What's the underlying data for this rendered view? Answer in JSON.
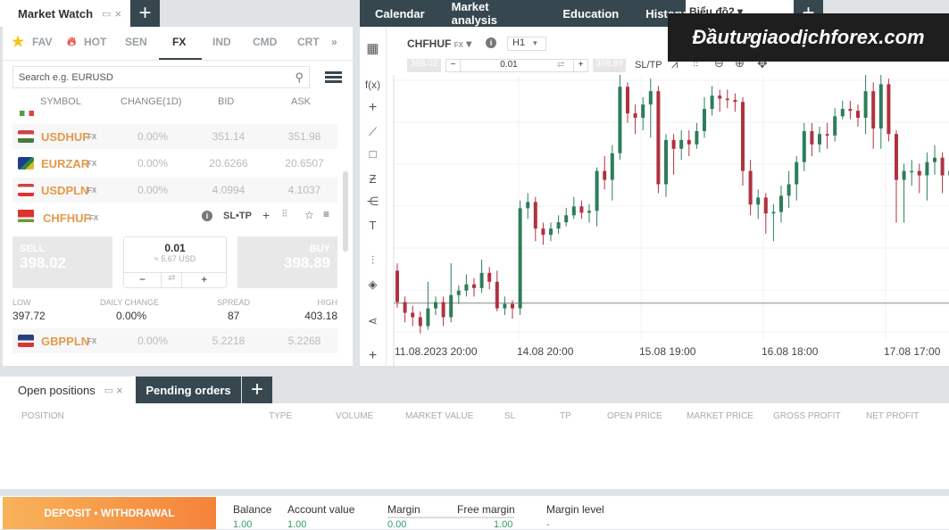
{
  "market_watch": {
    "title": "Market Watch",
    "categories": [
      "FAV",
      "HOT",
      "SEN",
      "FX",
      "IND",
      "CMD",
      "CRT"
    ],
    "active_category": "FX",
    "search_placeholder": "Search e.g. EURUSD",
    "columns": [
      "SYMBOL",
      "CHANGE(1D)",
      "BID",
      "ASK"
    ],
    "rows": [
      {
        "symbol": "USDHUF",
        "type": "FX",
        "change": "0.00%",
        "bid": "351.14",
        "ask": "351.98"
      },
      {
        "symbol": "EURZAR",
        "type": "FX",
        "change": "0.00%",
        "bid": "20.6266",
        "ask": "20.6507"
      },
      {
        "symbol": "USDPLN",
        "type": "FX",
        "change": "0.00%",
        "bid": "4.0994",
        "ask": "4.1037"
      },
      {
        "symbol": "GBPPLN",
        "type": "FX",
        "change": "0.00%",
        "bid": "5.2218",
        "ask": "5.2268"
      }
    ],
    "expanded": {
      "symbol": "CHFHUF",
      "type": "FX",
      "sltp": "SL•TP",
      "sell_label": "SELL",
      "sell_price": "398.02",
      "buy_label": "BUY",
      "buy_price": "398.89",
      "volume": "0.01",
      "volume_usd": "≈ 5.67 USD",
      "minus": "−",
      "plus": "+",
      "low_label": "LOW",
      "low": "397.72",
      "daily_change_label": "DAILY CHANGE",
      "daily_change": "0.00%",
      "spread_label": "SPREAD",
      "spread": "87",
      "high_label": "HIGH",
      "high": "403.18"
    }
  },
  "top_tabs": [
    "Calendar",
    "Market analysis",
    "Education",
    "History"
  ],
  "chart_tab": "Biểu đồ2",
  "watermark": "Đầutưgiaodịchforex.com",
  "chart_toolbar": {
    "symbol": "CHFHUF",
    "type": "FX",
    "timeframe": "H1",
    "sell": "398.02",
    "volume": "0.01",
    "buy": "398.89",
    "sltp": "SL/TP",
    "fx_label": "f(x)"
  },
  "chart_data": {
    "type": "candlestick",
    "x_tick_labels": [
      "11.08.2023 20:00",
      "14.08 20:00",
      "15.08 19:00",
      "16.08 18:00",
      "17.08 17:00"
    ],
    "current_price_line": 398.02,
    "colors": {
      "up": "#2e7d5b",
      "down": "#b0323f"
    },
    "ylim": [
      397.0,
      404.2
    ],
    "ohlc": [
      [
        398.9,
        399.1,
        397.9,
        398.05
      ],
      [
        398.05,
        398.2,
        397.5,
        397.76
      ],
      [
        397.76,
        397.95,
        397.4,
        397.64
      ],
      [
        397.64,
        397.8,
        397.2,
        397.4
      ],
      [
        397.4,
        398.6,
        397.3,
        397.88
      ],
      [
        397.88,
        398.2,
        397.7,
        398.05
      ],
      [
        398.05,
        398.2,
        397.4,
        397.64
      ],
      [
        397.64,
        399.1,
        397.5,
        398.24
      ],
      [
        398.24,
        398.5,
        398.0,
        398.36
      ],
      [
        398.36,
        398.8,
        398.2,
        398.53
      ],
      [
        398.53,
        398.7,
        398.2,
        398.43
      ],
      [
        398.43,
        399.2,
        398.3,
        398.84
      ],
      [
        398.84,
        399.0,
        398.4,
        398.6
      ],
      [
        398.6,
        398.9,
        397.8,
        397.88
      ],
      [
        397.88,
        398.2,
        397.7,
        398.0
      ],
      [
        398.0,
        398.1,
        397.6,
        397.88
      ],
      [
        397.88,
        400.8,
        397.7,
        400.59
      ],
      [
        400.59,
        401.0,
        400.3,
        400.76
      ],
      [
        400.76,
        400.9,
        399.7,
        400.04
      ],
      [
        400.04,
        400.2,
        399.6,
        399.87
      ],
      [
        399.87,
        400.2,
        399.7,
        400.04
      ],
      [
        400.04,
        400.4,
        399.9,
        400.21
      ],
      [
        400.21,
        400.6,
        400.1,
        400.4
      ],
      [
        400.4,
        400.9,
        400.3,
        400.64
      ],
      [
        400.64,
        400.8,
        400.3,
        400.47
      ],
      [
        400.47,
        400.7,
        400.2,
        400.52
      ],
      [
        400.52,
        401.7,
        400.1,
        401.6
      ],
      [
        401.6,
        402.0,
        401.1,
        401.36
      ],
      [
        401.36,
        402.3,
        400.8,
        402.08
      ],
      [
        402.08,
        404.2,
        401.9,
        403.88
      ],
      [
        403.88,
        404.0,
        402.9,
        403.16
      ],
      [
        403.16,
        403.4,
        402.6,
        403.04
      ],
      [
        403.04,
        403.6,
        402.7,
        403.4
      ],
      [
        403.4,
        404.1,
        402.5,
        403.76
      ],
      [
        403.76,
        403.9,
        401.0,
        401.24
      ],
      [
        401.24,
        402.6,
        400.9,
        402.44
      ],
      [
        402.44,
        402.6,
        401.5,
        402.2
      ],
      [
        402.2,
        402.7,
        401.9,
        402.44
      ],
      [
        402.44,
        402.7,
        402.0,
        402.32
      ],
      [
        402.32,
        402.9,
        402.2,
        402.68
      ],
      [
        402.68,
        403.6,
        402.5,
        403.28
      ],
      [
        403.28,
        403.9,
        403.1,
        403.64
      ],
      [
        403.64,
        403.8,
        403.2,
        403.56
      ],
      [
        403.56,
        403.8,
        403.3,
        403.52
      ],
      [
        403.52,
        403.7,
        403.2,
        403.47
      ],
      [
        403.47,
        403.6,
        401.2,
        401.6
      ],
      [
        401.6,
        401.9,
        400.4,
        400.69
      ],
      [
        400.69,
        401.1,
        400.3,
        400.88
      ],
      [
        400.88,
        401.0,
        399.9,
        400.45
      ],
      [
        400.45,
        400.7,
        399.7,
        400.49
      ],
      [
        400.49,
        401.2,
        400.2,
        400.93
      ],
      [
        400.93,
        401.6,
        400.6,
        401.24
      ],
      [
        401.24,
        402.0,
        400.8,
        401.84
      ],
      [
        401.84,
        402.9,
        401.6,
        402.68
      ],
      [
        402.68,
        402.9,
        402.0,
        402.32
      ],
      [
        402.32,
        402.8,
        402.1,
        402.6
      ],
      [
        402.6,
        402.9,
        402.2,
        402.56
      ],
      [
        402.56,
        403.3,
        402.4,
        403.08
      ],
      [
        403.08,
        403.5,
        403.0,
        403.28
      ],
      [
        403.28,
        403.5,
        403.0,
        403.23
      ],
      [
        403.23,
        403.4,
        402.8,
        403.04
      ],
      [
        403.04,
        404.2,
        402.6,
        403.76
      ],
      [
        403.76,
        404.0,
        402.2,
        402.75
      ],
      [
        402.75,
        404.2,
        402.2,
        403.95
      ],
      [
        403.95,
        404.1,
        402.4,
        402.6
      ],
      [
        402.6,
        402.7,
        400.2,
        401.36
      ],
      [
        401.36,
        401.8,
        400.2,
        401.6
      ],
      [
        401.6,
        401.9,
        401.2,
        401.6
      ],
      [
        401.6,
        401.8,
        401.0,
        401.48
      ],
      [
        401.48,
        402.1,
        400.8,
        401.84
      ],
      [
        401.84,
        402.3,
        401.5,
        401.96
      ],
      [
        401.96,
        402.1,
        401.0,
        401.48
      ],
      [
        401.48,
        401.9,
        401.1,
        401.6
      ]
    ]
  },
  "bottom": {
    "tabs": [
      "Open positions",
      "Pending orders"
    ],
    "columns": [
      "POSITION",
      "TYPE",
      "VOLUME",
      "MARKET VALUE",
      "SL",
      "TP",
      "OPEN PRICE",
      "MARKET PRICE",
      "GROSS PROFIT",
      "NET PROFIT"
    ],
    "deposit_label": "DEPOSIT • WITHDRAWAL",
    "account": [
      {
        "label": "Balance",
        "value": "1.00"
      },
      {
        "label": "Account value",
        "value": "1.00"
      },
      {
        "label": "Margin",
        "value": "0.00"
      },
      {
        "label": "Free margin",
        "value": "1.00"
      },
      {
        "label": "Margin level",
        "value": "-"
      }
    ]
  }
}
